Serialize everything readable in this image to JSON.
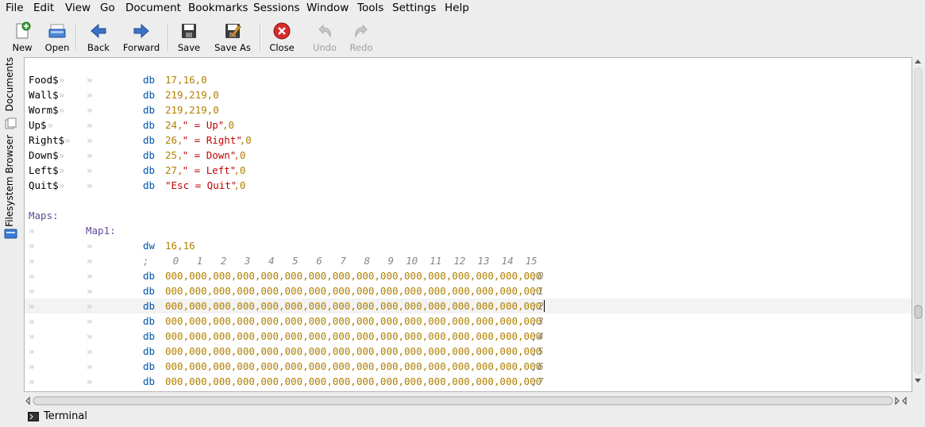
{
  "menubar": {
    "items": [
      "File",
      "Edit",
      "View",
      "Go",
      "Document",
      "Bookmarks",
      "Sessions",
      "Window",
      "Tools",
      "Settings",
      "Help"
    ]
  },
  "toolbar": {
    "buttons": [
      {
        "label": "New",
        "icon": "new-document-icon",
        "enabled": true
      },
      {
        "label": "Open",
        "icon": "open-icon",
        "enabled": true
      },
      {
        "label": "Back",
        "icon": "back-arrow-icon",
        "enabled": true
      },
      {
        "label": "Forward",
        "icon": "forward-arrow-icon",
        "enabled": true
      },
      {
        "label": "Save",
        "icon": "save-icon",
        "enabled": true
      },
      {
        "label": "Save As",
        "icon": "save-as-icon",
        "enabled": true
      },
      {
        "label": "Close",
        "icon": "close-icon",
        "enabled": true
      },
      {
        "label": "Undo",
        "icon": "undo-icon",
        "enabled": false
      },
      {
        "label": "Redo",
        "icon": "redo-icon",
        "enabled": false
      }
    ]
  },
  "sidebar": {
    "tabs": [
      {
        "label": "Documents",
        "icon": "documents-icon"
      },
      {
        "label": "Filesystem Browser",
        "icon": "filesystem-icon"
      }
    ]
  },
  "editor": {
    "lines": [
      {
        "label": "Food$",
        "instr": "db",
        "args": [
          [
            "num",
            "17,16,0"
          ]
        ]
      },
      {
        "label": "Wall$",
        "instr": "db",
        "args": [
          [
            "num",
            "219,219,0"
          ]
        ]
      },
      {
        "label": "Worm$",
        "instr": "db",
        "args": [
          [
            "num",
            "219,219,0"
          ]
        ]
      },
      {
        "label": "Up$",
        "instr": "db",
        "args": [
          [
            "num",
            "24,"
          ],
          [
            "str",
            "\" = Up\""
          ],
          [
            "num",
            ",0"
          ]
        ]
      },
      {
        "label": "Right$",
        "instr": "db",
        "args": [
          [
            "num",
            "26,"
          ],
          [
            "str",
            "\" = Right\""
          ],
          [
            "num",
            ",0"
          ]
        ]
      },
      {
        "label": "Down$",
        "instr": "db",
        "args": [
          [
            "num",
            "25,"
          ],
          [
            "str",
            "\" = Down\""
          ],
          [
            "num",
            ",0"
          ]
        ]
      },
      {
        "label": "Left$",
        "instr": "db",
        "args": [
          [
            "num",
            "27,"
          ],
          [
            "str",
            "\" = Left\""
          ],
          [
            "num",
            ",0"
          ]
        ]
      },
      {
        "label": "Quit$",
        "instr": "db",
        "args": [
          [
            "str",
            "\"Esc = Quit\""
          ],
          [
            "num",
            ",0"
          ]
        ]
      }
    ],
    "section_label": "Maps:",
    "sub_label": "Map1:",
    "dw_instr": "dw",
    "dw_args": "16,16",
    "header_comment": ";    0   1   2   3   4   5   6   7   8   9  10  11  12  13  14  15",
    "row_instr": "db",
    "row_values": "000,000,000,000,000,000,000,000,000,000,000,000,000,000,000,000",
    "row_comments": [
      ";0",
      ";1",
      ";2",
      ";3",
      ";4",
      ";5",
      ";6",
      ";7"
    ],
    "tab_marker": "»",
    "current_line_index": 2
  },
  "bottombar": {
    "terminal_label": "Terminal",
    "terminal_icon": "terminal-icon"
  },
  "colors": {
    "keyword": "#0057ae",
    "number": "#b08000",
    "string": "#bf0303",
    "section": "#644a9b",
    "comment": "#888786"
  }
}
